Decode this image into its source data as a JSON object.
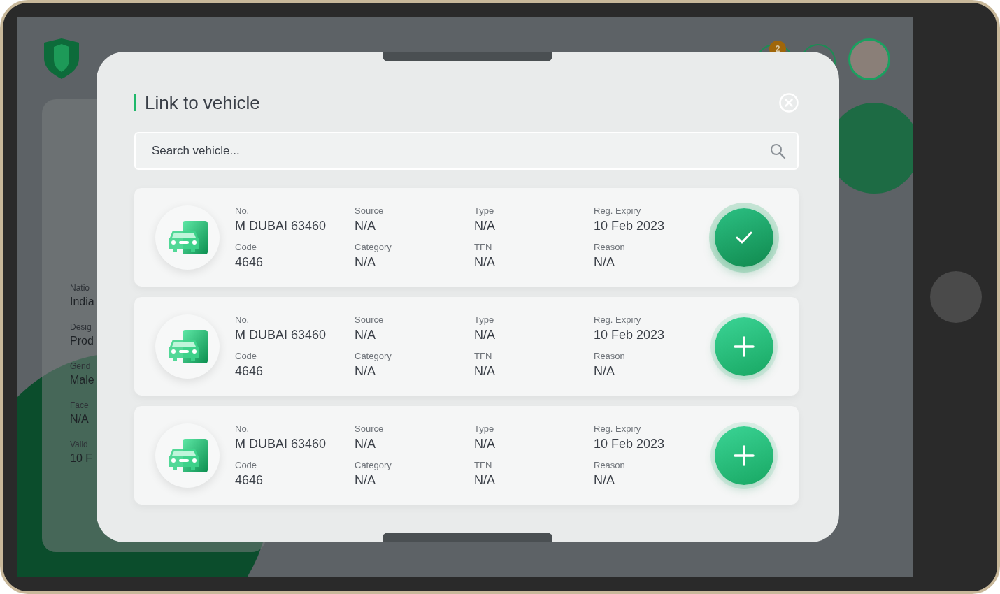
{
  "header": {
    "notification_count": "2"
  },
  "profile": {
    "details": [
      {
        "label": "Natio",
        "value": "India"
      },
      {
        "label": "Desig",
        "value": "Prod"
      },
      {
        "label": "Gend",
        "value": "Male"
      },
      {
        "label": "Face",
        "value": "N/A"
      },
      {
        "label": "Valid",
        "value": "10 F"
      }
    ]
  },
  "modal": {
    "title": "Link to vehicle",
    "search": {
      "placeholder": "Search vehicle..."
    },
    "vehicles": [
      {
        "selected": true,
        "fields": [
          {
            "label": "No.",
            "value": "M DUBAI 63460"
          },
          {
            "label": "Source",
            "value": "N/A"
          },
          {
            "label": "Type",
            "value": "N/A"
          },
          {
            "label": "Reg. Expiry",
            "value": "10 Feb 2023"
          },
          {
            "label": "Code",
            "value": "4646"
          },
          {
            "label": "Category",
            "value": "N/A"
          },
          {
            "label": "TFN",
            "value": "N/A"
          },
          {
            "label": "Reason",
            "value": "N/A"
          }
        ]
      },
      {
        "selected": false,
        "fields": [
          {
            "label": "No.",
            "value": "M DUBAI 63460"
          },
          {
            "label": "Source",
            "value": "N/A"
          },
          {
            "label": "Type",
            "value": "N/A"
          },
          {
            "label": "Reg. Expiry",
            "value": "10 Feb 2023"
          },
          {
            "label": "Code",
            "value": "4646"
          },
          {
            "label": "Category",
            "value": "N/A"
          },
          {
            "label": "TFN",
            "value": "N/A"
          },
          {
            "label": "Reason",
            "value": "N/A"
          }
        ]
      },
      {
        "selected": false,
        "fields": [
          {
            "label": "No.",
            "value": "M DUBAI 63460"
          },
          {
            "label": "Source",
            "value": "N/A"
          },
          {
            "label": "Type",
            "value": "N/A"
          },
          {
            "label": "Reg. Expiry",
            "value": "10 Feb 2023"
          },
          {
            "label": "Code",
            "value": "4646"
          },
          {
            "label": "Category",
            "value": "N/A"
          },
          {
            "label": "TFN",
            "value": "N/A"
          },
          {
            "label": "Reason",
            "value": "N/A"
          }
        ]
      }
    ]
  }
}
